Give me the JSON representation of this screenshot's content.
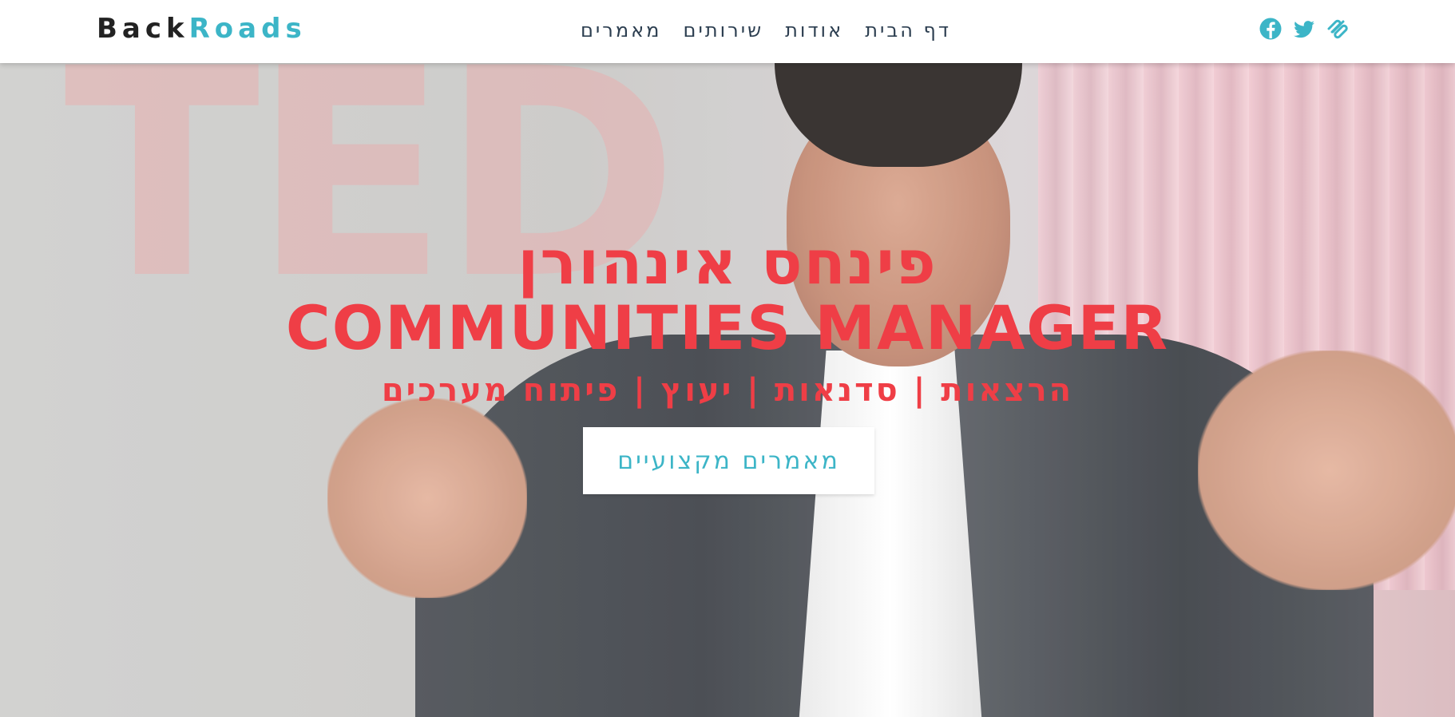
{
  "navbar": {
    "logo": {
      "part1": "Back",
      "part2": "Roads"
    },
    "links": [
      {
        "label": "דף הבית"
      },
      {
        "label": "אודות"
      },
      {
        "label": "שירותים"
      },
      {
        "label": "מאמרים"
      }
    ],
    "social": [
      "facebook-icon",
      "twitter-icon",
      "squarespace-icon"
    ]
  },
  "hero": {
    "name": "פינחס אינהורן",
    "role": "COMMUNITIES MANAGER",
    "services": "הרצאות | סדנאות | יעוץ | פיתוח מערכים",
    "button_label": "מאמרים מקצועיים"
  },
  "colors": {
    "accent": "#3cb5c7",
    "title": "#ef3e46",
    "logo_dark": "#222222",
    "nav_text": "#2c3e50"
  }
}
